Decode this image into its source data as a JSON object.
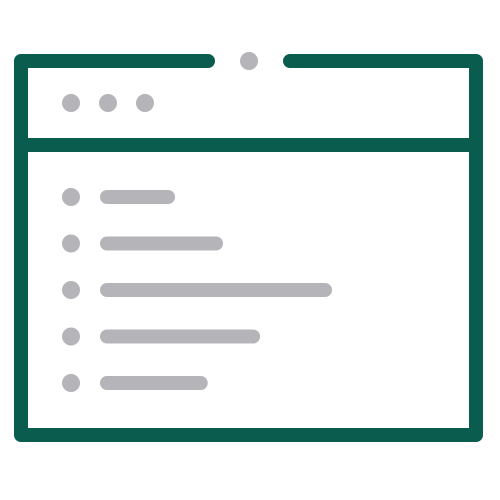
{
  "icon": {
    "name": "browser-window-list-icon",
    "colors": {
      "frame": "#0a5c4e",
      "content": "#b5b4b9",
      "background": "#ffffff"
    },
    "window_dots": 3,
    "list_rows": [
      {
        "line_fraction": 0.28
      },
      {
        "line_fraction": 0.5
      },
      {
        "line_fraction": 1.0
      },
      {
        "line_fraction": 0.67
      },
      {
        "line_fraction": 0.43
      }
    ]
  }
}
